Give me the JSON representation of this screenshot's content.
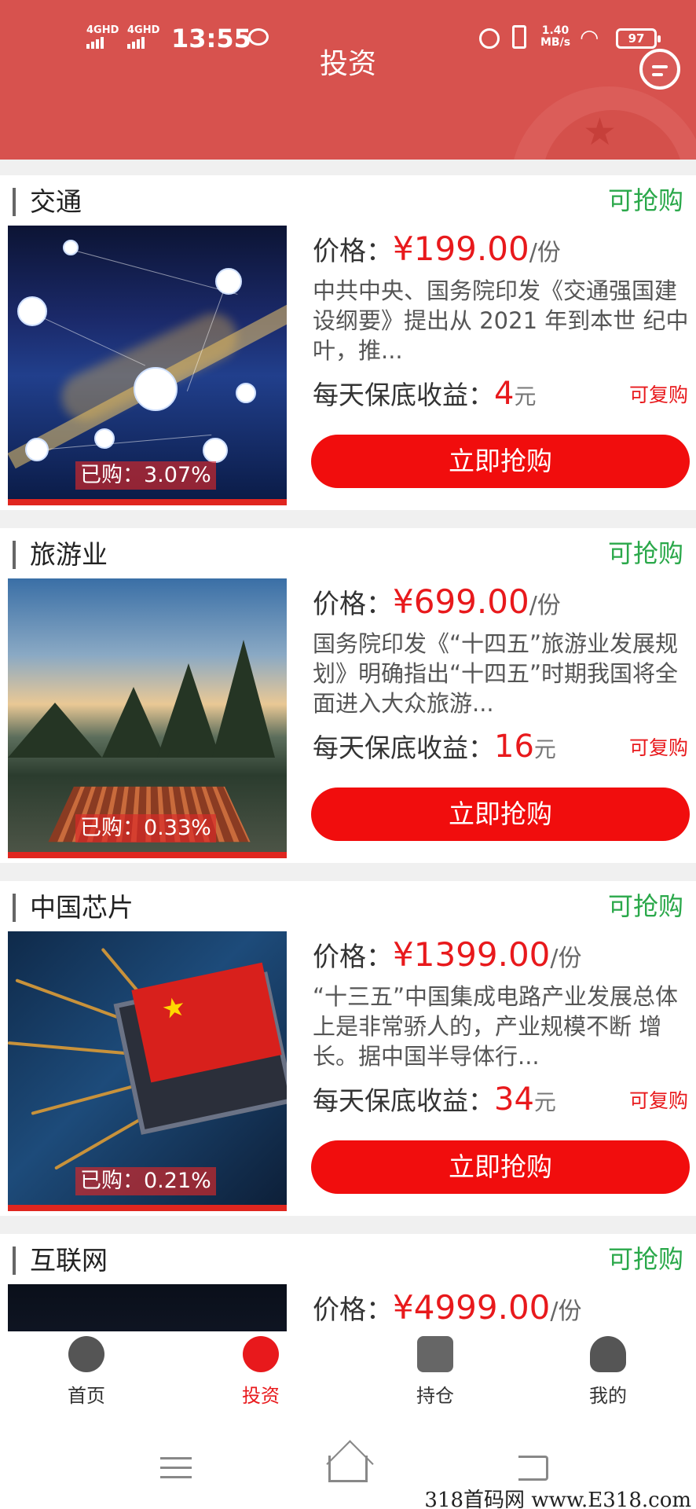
{
  "status_bar": {
    "signal1": "4GHD",
    "signal2": "4GHD",
    "time": "13:55",
    "net_speed_value": "1.40",
    "net_speed_unit": "MB/s",
    "battery": "97"
  },
  "header": {
    "title": "投资"
  },
  "products": [
    {
      "title": "交通",
      "status": "可抢购",
      "price_label": "价格：",
      "price": "¥199.00",
      "price_unit": "/份",
      "description": "中共中央、国务院印发《交通强国建设纲要》提出从 2021 年到本世 纪中叶，推...",
      "income_label": "每天保底收益：",
      "income": "4",
      "income_unit": "元",
      "repeat": "可复购",
      "bought": "已购：3.07%",
      "bought_fraction": 0.0307,
      "button": "立即抢购"
    },
    {
      "title": "旅游业",
      "status": "可抢购",
      "price_label": "价格：",
      "price": "¥699.00",
      "price_unit": "/份",
      "description": "国务院印发《“十四五”旅游业发展规划》明确指出“十四五”时期我国将全面进入大众旅游...",
      "income_label": "每天保底收益：",
      "income": "16",
      "income_unit": "元",
      "repeat": "可复购",
      "bought": "已购：0.33%",
      "bought_fraction": 0.0033,
      "button": "立即抢购"
    },
    {
      "title": "中国芯片",
      "status": "可抢购",
      "price_label": "价格：",
      "price": "¥1399.00",
      "price_unit": "/份",
      "description": "“十三五”中国集成电路产业发展总体上是非常骄人的，产业规模不断 增长。据中国半导体行...",
      "income_label": "每天保底收益：",
      "income": "34",
      "income_unit": "元",
      "repeat": "可复购",
      "bought": "已购：0.21%",
      "bought_fraction": 0.0021,
      "button": "立即抢购"
    },
    {
      "title": "互联网",
      "status": "可抢购",
      "price_label": "价格：",
      "price": "¥4999.00",
      "price_unit": "/份"
    }
  ],
  "bottom_nav": {
    "items": [
      {
        "label": "首页",
        "icon": "home-globe-icon"
      },
      {
        "label": "投资",
        "icon": "invest-globe-icon",
        "active": true
      },
      {
        "label": "持仓",
        "icon": "holdings-yen-icon"
      },
      {
        "label": "我的",
        "icon": "profile-person-icon"
      }
    ]
  },
  "watermark": "318首码网 www.E318.com",
  "colors": {
    "header_bg": "#d7524e",
    "accent_red": "#f10d0d",
    "status_green": "#2aa84a"
  }
}
